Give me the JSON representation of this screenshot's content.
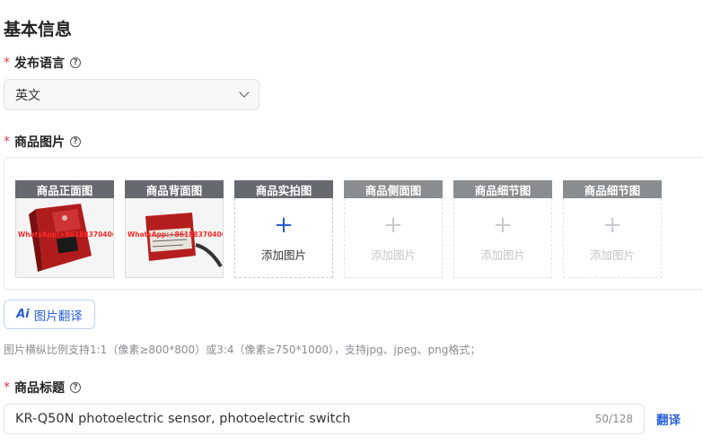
{
  "section_title": "基本信息",
  "language": {
    "required_mark": "*",
    "label": "发布语言",
    "help": "?",
    "selected": "英文"
  },
  "images": {
    "required_mark": "*",
    "label": "商品图片",
    "help": "?",
    "slots": [
      {
        "title": "商品正面图",
        "state": "filled",
        "watermark": "WhatsApp:+8618837040688"
      },
      {
        "title": "商品背面图",
        "state": "filled",
        "watermark": "WhatsApp:+8618837040688"
      },
      {
        "title": "商品实拍图",
        "state": "empty-active",
        "plus": "+",
        "add_text": "添加图片"
      },
      {
        "title": "商品侧面图",
        "state": "empty-disabled",
        "plus": "+",
        "add_text": "添加图片"
      },
      {
        "title": "商品细节图",
        "state": "empty-disabled",
        "plus": "+",
        "add_text": "添加图片"
      },
      {
        "title": "商品细节图",
        "state": "empty-disabled",
        "plus": "+",
        "add_text": "添加图片"
      }
    ],
    "translate_button": {
      "icon_text": "Ai",
      "label": "图片翻译"
    },
    "hint": "图片横纵比例支持1:1（像素≥800*800）或3:4（像素≥750*1000），支持jpg、jpeg、png格式；"
  },
  "product_title": {
    "required_mark": "*",
    "label": "商品标题",
    "help": "?",
    "value": "KR-Q50N photoelectric sensor, photoelectric switch",
    "count": "50/128",
    "translate_link": "翻译"
  },
  "colors": {
    "accent": "#2a5fd9",
    "required": "#e0393e",
    "slot_header_dark": "#666a6e",
    "slot_header_light": "#8a8d90"
  }
}
